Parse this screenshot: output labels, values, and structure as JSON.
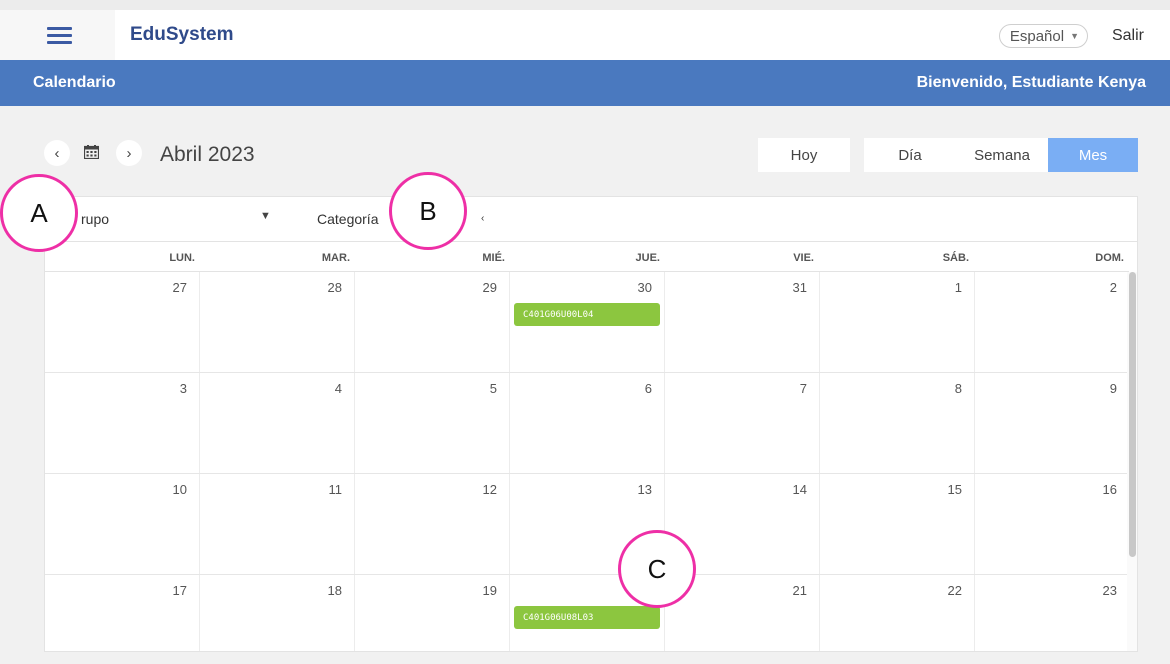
{
  "app": {
    "brand": "EduSystem",
    "language": "Español",
    "logout": "Salir"
  },
  "header": {
    "section": "Calendario",
    "welcome": "Bienvenido, Estudiante Kenya"
  },
  "toolbar": {
    "month_title": "Abril 2023",
    "prev": "‹",
    "next": "›",
    "today": "Hoy",
    "views": [
      "Día",
      "Semana",
      "Mes"
    ],
    "active_view": "Mes"
  },
  "filters": {
    "group": "rupo",
    "category": "Categoría",
    "category_trail": "‹"
  },
  "calendar": {
    "weekdays": [
      "LUN.",
      "MAR.",
      "MIÉ.",
      "JUE.",
      "VIE.",
      "SÁB.",
      "DOM."
    ],
    "weeks": [
      [
        "27",
        "28",
        "29",
        "30",
        "31",
        "1",
        "2"
      ],
      [
        "3",
        "4",
        "5",
        "6",
        "7",
        "8",
        "9"
      ],
      [
        "10",
        "11",
        "12",
        "13",
        "14",
        "15",
        "16"
      ],
      [
        "17",
        "18",
        "19",
        "",
        "21",
        "22",
        "23"
      ]
    ],
    "events": [
      {
        "label": "C401G06U00L04",
        "week": 0,
        "day": 3,
        "color": "#8cc63f"
      },
      {
        "label": "C401G06U08L03",
        "week": 3,
        "day": 3,
        "color": "#8cc63f"
      }
    ]
  },
  "markers": [
    "A",
    "B",
    "C"
  ],
  "colors": {
    "accent_blue": "#4a79bf",
    "active_view": "#7aaef4",
    "event_green": "#8cc63f",
    "marker_border": "#ee2fa6"
  }
}
